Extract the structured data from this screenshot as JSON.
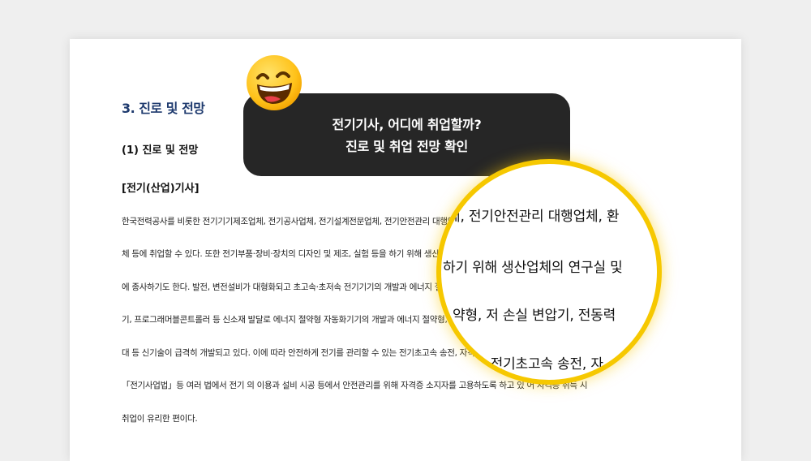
{
  "document": {
    "heading1": "3. 진로 및 전망",
    "heading2": "(1) 진로 및 전망",
    "heading3": "[전기(산업)기사]",
    "lines": [
      "한국전력공사를 비롯한 전기기기제조업체, 전기공사업체, 전기설계전문업체, 전기안전관리 대행업체, 환경시설업",
      "체 등에 취업할 수 있다. 또한 전기부품·장비·장치의 디자인 및 제조, 실험 등을 하기 위해 생산업체의 연구실 및 개발실",
      "에 종사하기도 한다.  발전, 변전설비가 대형화되고 초고속·초저속 전기기기의 개발과 에너지 절약형, 저 손실 변압기, 전동력 속도제어",
      "기, 프로그래머블콘트롤러 등 신소재 발달로 에너지 절약형 자동화기기의 개발과 에너지 절약형, 저 손실 변압기 에너지 이용확",
      "대 등 신기술이 급격히 개발되고 있다. 이에 따라 안전하게 전기를 관리할 수 있는 전기초고속 송전, 자격 로 예상된다. 그리고",
      "「전기사업법」등 여러 법에서 전기 의 이용과 설비 시공 등에서 안전관리를 위해 자격증 소지자를 고용하도록 하고 있 어 자격증 취득 시",
      "취업이 유리한 편이다."
    ]
  },
  "bubble": {
    "line1": "전기기사, 어디에 취업할까?",
    "line2": "진로 및 취업 전망 확인"
  },
  "magnifier": {
    "lines": [
      "체, 전기안전관리 대행업체, 환",
      "하기 위해 생산업체의 연구실 및",
      "약형, 저 손실 변압기, 전동력",
      "는 전기초고속 송전, 자"
    ]
  },
  "colors": {
    "heading": "#1e3a6e",
    "bubble": "#262626",
    "ring": "#f6c800",
    "background": "#efefef"
  },
  "icons": {
    "emoji": "grinning-face-emoji"
  }
}
